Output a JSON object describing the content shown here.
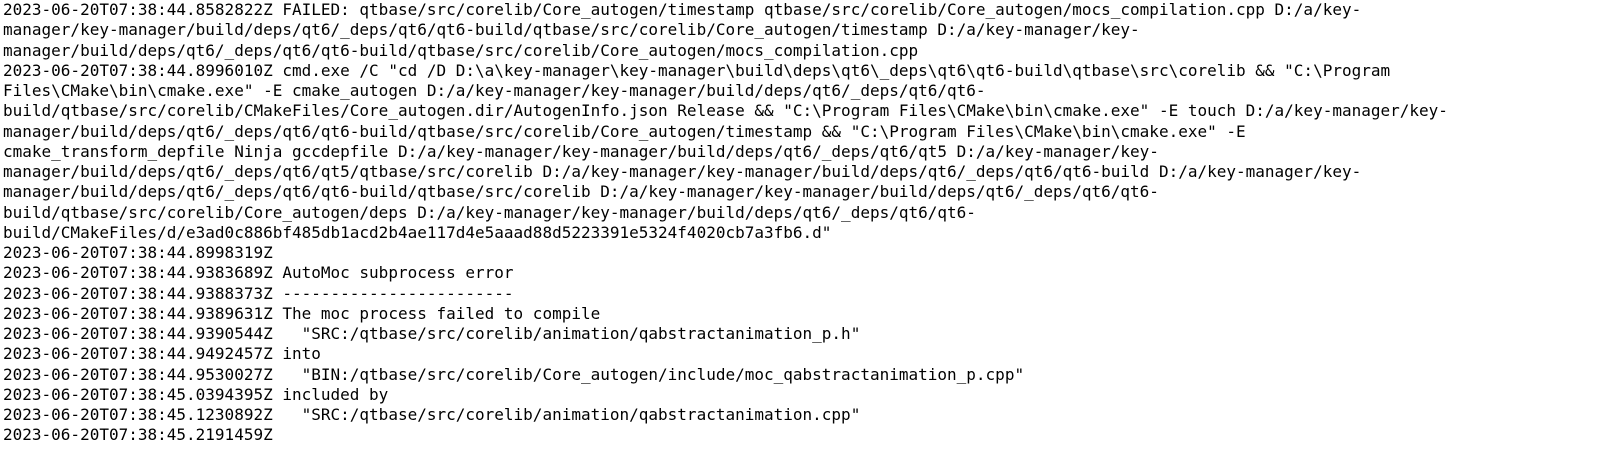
{
  "log": {
    "lines": [
      "2023-06-20T07:38:44.8582822Z FAILED: qtbase/src/corelib/Core_autogen/timestamp qtbase/src/corelib/Core_autogen/mocs_compilation.cpp D:/a/key-",
      "manager/key-manager/build/deps/qt6/_deps/qt6/qt6-build/qtbase/src/corelib/Core_autogen/timestamp D:/a/key-manager/key-",
      "manager/build/deps/qt6/_deps/qt6/qt6-build/qtbase/src/corelib/Core_autogen/mocs_compilation.cpp",
      "2023-06-20T07:38:44.8996010Z cmd.exe /C \"cd /D D:\\a\\key-manager\\key-manager\\build\\deps\\qt6\\_deps\\qt6\\qt6-build\\qtbase\\src\\corelib && \"C:\\Program",
      "Files\\CMake\\bin\\cmake.exe\" -E cmake_autogen D:/a/key-manager/key-manager/build/deps/qt6/_deps/qt6/qt6-",
      "build/qtbase/src/corelib/CMakeFiles/Core_autogen.dir/AutogenInfo.json Release && \"C:\\Program Files\\CMake\\bin\\cmake.exe\" -E touch D:/a/key-manager/key-",
      "manager/build/deps/qt6/_deps/qt6/qt6-build/qtbase/src/corelib/Core_autogen/timestamp && \"C:\\Program Files\\CMake\\bin\\cmake.exe\" -E",
      "cmake_transform_depfile Ninja gccdepfile D:/a/key-manager/key-manager/build/deps/qt6/_deps/qt6/qt5 D:/a/key-manager/key-",
      "manager/build/deps/qt6/_deps/qt6/qt5/qtbase/src/corelib D:/a/key-manager/key-manager/build/deps/qt6/_deps/qt6/qt6-build D:/a/key-manager/key-",
      "manager/build/deps/qt6/_deps/qt6/qt6-build/qtbase/src/corelib D:/a/key-manager/key-manager/build/deps/qt6/_deps/qt6/qt6-",
      "build/qtbase/src/corelib/Core_autogen/deps D:/a/key-manager/key-manager/build/deps/qt6/_deps/qt6/qt6-",
      "build/CMakeFiles/d/e3ad0c886bf485db1acd2b4ae117d4e5aaad88d5223391e5324f4020cb7a3fb6.d\"",
      "2023-06-20T07:38:44.8998319Z",
      "2023-06-20T07:38:44.9383689Z AutoMoc subprocess error",
      "2023-06-20T07:38:44.9388373Z ------------------------",
      "2023-06-20T07:38:44.9389631Z The moc process failed to compile",
      "2023-06-20T07:38:44.9390544Z   \"SRC:/qtbase/src/corelib/animation/qabstractanimation_p.h\"",
      "2023-06-20T07:38:44.9492457Z into",
      "2023-06-20T07:38:44.9530027Z   \"BIN:/qtbase/src/corelib/Core_autogen/include/moc_qabstractanimation_p.cpp\"",
      "2023-06-20T07:38:45.0394395Z included by",
      "2023-06-20T07:38:45.1230892Z   \"SRC:/qtbase/src/corelib/animation/qabstractanimation.cpp\"",
      "2023-06-20T07:38:45.2191459Z"
    ]
  }
}
